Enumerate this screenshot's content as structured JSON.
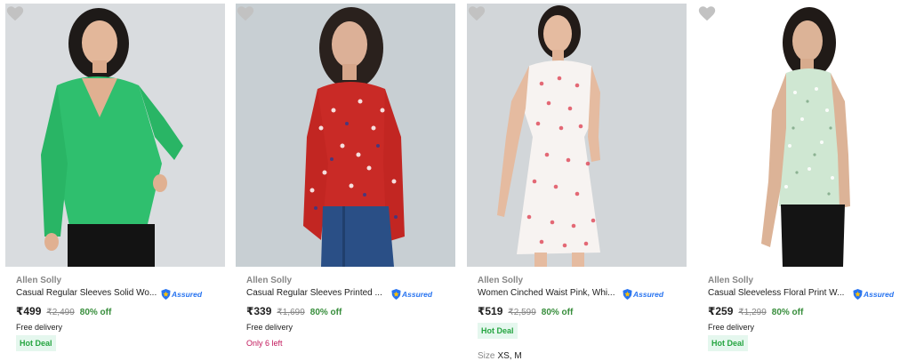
{
  "products": [
    {
      "brand": "Allen Solly",
      "title": "Casual Regular Sleeves Solid Wo...",
      "assured_label": "Assured",
      "price": "₹499",
      "mrp": "₹2,499",
      "discount": "80% off",
      "delivery": "Free delivery",
      "badge": "Hot Deal",
      "image_icon": "product-photo-green-blouse"
    },
    {
      "brand": "Allen Solly",
      "title": "Casual Regular Sleeves Printed ...",
      "assured_label": "Assured",
      "price": "₹339",
      "mrp": "₹1,699",
      "discount": "80% off",
      "delivery": "Free delivery",
      "stock_note": "Only 6 left",
      "image_icon": "product-photo-red-floral-crop-top"
    },
    {
      "brand": "Allen Solly",
      "title": "Women Cinched Waist Pink, Whi...",
      "assured_label": "Assured",
      "price": "₹519",
      "mrp": "₹2,599",
      "discount": "80% off",
      "badge": "Hot Deal",
      "size_label": "Size",
      "sizes": "XS, M",
      "image_icon": "product-photo-white-printed-dress"
    },
    {
      "brand": "Allen Solly",
      "title": "Casual Sleeveless Floral Print W...",
      "assured_label": "Assured",
      "price": "₹259",
      "mrp": "₹1,299",
      "discount": "80% off",
      "delivery": "Free delivery",
      "badge": "Hot Deal",
      "image_icon": "product-photo-mint-floral-top"
    }
  ],
  "colors": {
    "discount_green": "#388e3c",
    "assured_blue": "#2874f0",
    "hot_deal_bg": "#e5f7ee",
    "stock_pink": "#c2185b",
    "wishlist_grey": "#c2c2c2"
  }
}
